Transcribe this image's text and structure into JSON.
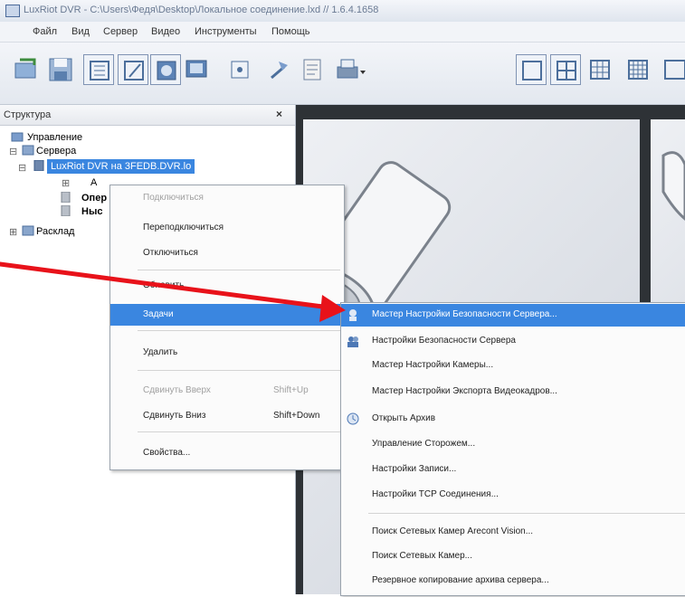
{
  "window": {
    "title": "LuxRiot DVR - C:\\Users\\Федя\\Desktop\\Локальное соединение.lxd // 1.6.4.1658"
  },
  "menu": {
    "items": [
      "Файл",
      "Вид",
      "Сервер",
      "Видео",
      "Инструменты",
      "Помощь"
    ]
  },
  "toolbar": {
    "icons": [
      "connect-icon",
      "save-icon",
      "layout-list-icon",
      "edit-icon",
      "camera-icon",
      "monitor-icon",
      "fullscreen-icon",
      "play-icon",
      "archive-icon",
      "print-icon",
      "layout-1-icon",
      "layout-4-icon",
      "layout-9-icon",
      "layout-16-icon"
    ]
  },
  "structure": {
    "header": "Структура",
    "close": "×",
    "tree": {
      "root": "Управление",
      "servers": "Сервера",
      "server": "LuxRiot DVR на 3FEDB.DVR.lo",
      "child_fragment": "А",
      "item2": "Опер",
      "item3": "Ныс",
      "layouts": "Расклад"
    }
  },
  "context_menu": {
    "items": [
      {
        "label": "Подключиться",
        "disabled": true
      },
      {
        "label": "Переподключиться",
        "disabled": false
      },
      {
        "label": "Отключиться",
        "disabled": false
      },
      {
        "label": "Обновить",
        "disabled": false
      },
      {
        "label": "Задачи",
        "selected": true
      },
      {
        "label": "Удалить",
        "disabled": false
      },
      {
        "label": "Сдвинуть Вверх",
        "shortcut": "Shift+Up",
        "disabled": true
      },
      {
        "label": "Сдвинуть Вниз",
        "shortcut": "Shift+Down",
        "disabled": false
      },
      {
        "label": "Свойства...",
        "disabled": false
      }
    ]
  },
  "tasks_submenu": {
    "items": [
      {
        "label": "Мастер Настройки Безопасности Сервера...",
        "selected": true,
        "icon": "security-wizard-icon"
      },
      {
        "label": "Настройки Безопасности Сервера",
        "icon": "users-icon"
      },
      {
        "label": "Мастер Настройки Камеры..."
      },
      {
        "label": "Мастер Настройки Экспорта Видеокадров..."
      },
      {
        "label": "Открыть Архив",
        "icon": "archive-icon"
      },
      {
        "label": "Управление Сторожем..."
      },
      {
        "label": "Настройки Записи..."
      },
      {
        "label": "Настройки TCP Соединения..."
      },
      {
        "label": "Поиск Сетевых Камер Arecont Vision..."
      },
      {
        "label": "Поиск Сетевых Камер..."
      },
      {
        "label": "Резервное копирование архива сервера..."
      }
    ]
  },
  "annotation": {
    "color": "#e8121a"
  }
}
